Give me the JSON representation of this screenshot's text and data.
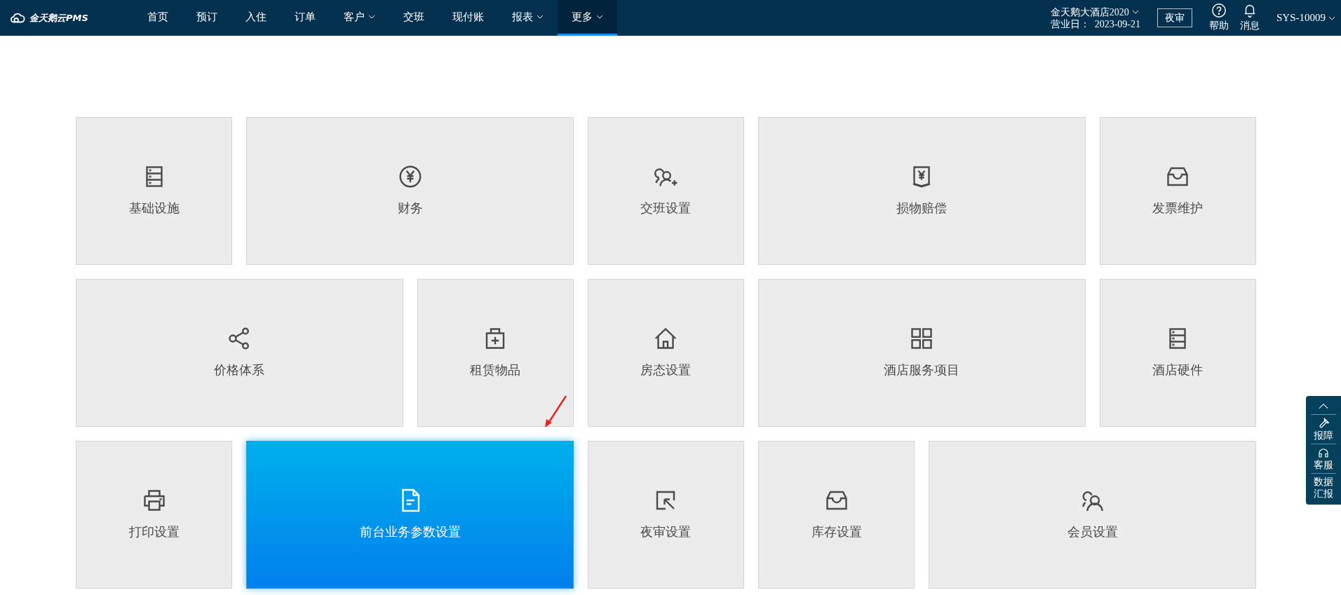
{
  "brand": {
    "name": "金天鹅云PMS"
  },
  "nav": [
    {
      "label": "首页",
      "dropdown": false,
      "selected": false
    },
    {
      "label": "预订",
      "dropdown": false,
      "selected": false
    },
    {
      "label": "入住",
      "dropdown": false,
      "selected": false
    },
    {
      "label": "订单",
      "dropdown": false,
      "selected": false
    },
    {
      "label": "客户",
      "dropdown": true,
      "selected": false
    },
    {
      "label": "交班",
      "dropdown": false,
      "selected": false
    },
    {
      "label": "现付账",
      "dropdown": false,
      "selected": false
    },
    {
      "label": "报表",
      "dropdown": true,
      "selected": false
    },
    {
      "label": "更多",
      "dropdown": true,
      "selected": true
    }
  ],
  "hotel": {
    "name": "金天鹅大酒店2020",
    "business_day": "营业日：  2023-09-21"
  },
  "night_audit_button": "夜审",
  "help": "帮助",
  "messages": "消息",
  "user": "SYS-10009",
  "tiles": [
    {
      "label": "基础设施",
      "kind": "narrow",
      "selected": false
    },
    {
      "label": "财务",
      "kind": "wide",
      "selected": false
    },
    {
      "label": "交班设置",
      "kind": "narrow",
      "selected": false
    },
    {
      "label": "损物赔偿",
      "kind": "wide",
      "selected": false
    },
    {
      "label": "发票维护",
      "kind": "narrow",
      "selected": false
    },
    {
      "label": "价格体系",
      "kind": "wide",
      "selected": false
    },
    {
      "label": "租赁物品",
      "kind": "narrow",
      "selected": false
    },
    {
      "label": "房态设置",
      "kind": "narrow",
      "selected": false
    },
    {
      "label": "酒店服务项目",
      "kind": "wide",
      "selected": false
    },
    {
      "label": "酒店硬件",
      "kind": "narrow",
      "selected": false
    },
    {
      "label": "打印设置",
      "kind": "narrow",
      "selected": false
    },
    {
      "label": "前台业务参数设置",
      "kind": "wide",
      "selected": true
    },
    {
      "label": "夜审设置",
      "kind": "narrow",
      "selected": false
    },
    {
      "label": "库存设置",
      "kind": "narrow",
      "selected": false
    },
    {
      "label": "会员设置",
      "kind": "wide",
      "selected": false
    }
  ],
  "side_panel": [
    {
      "label": "报障"
    },
    {
      "label": "客服"
    },
    {
      "label": "数据汇报"
    }
  ]
}
